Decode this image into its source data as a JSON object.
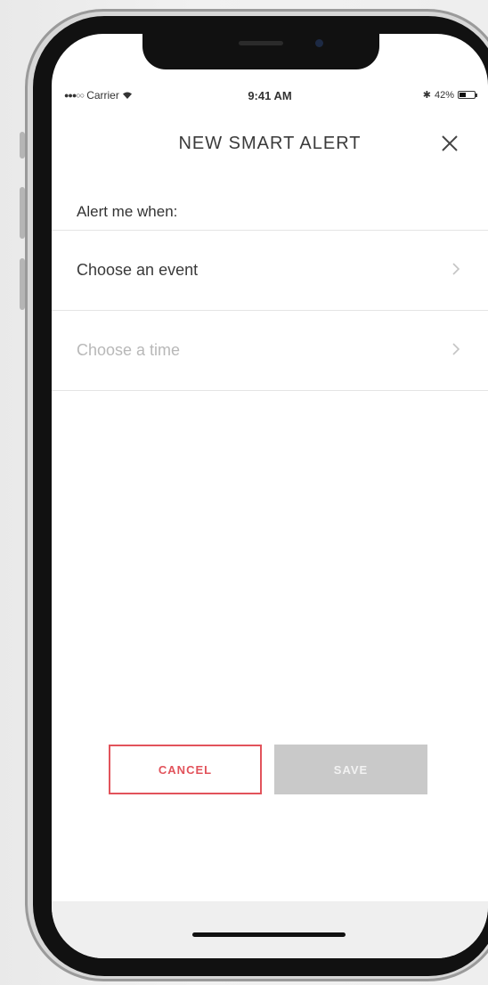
{
  "status_bar": {
    "carrier": "Carrier",
    "time": "9:41 AM",
    "bluetooth": "✱",
    "battery": "42%",
    "battery_level": 0.42
  },
  "header": {
    "title": "NEW SMART ALERT"
  },
  "form": {
    "section_label": "Alert me when:",
    "rows": [
      {
        "label": "Choose an event",
        "color": "#3a3a3a"
      },
      {
        "label": "Choose a time",
        "color": "#b8b8b8"
      }
    ]
  },
  "actions": {
    "cancel_label": "CANCEL",
    "save_label": "SAVE"
  },
  "colors": {
    "accent": "#e2535b",
    "disabled": "#c9c9c9"
  }
}
